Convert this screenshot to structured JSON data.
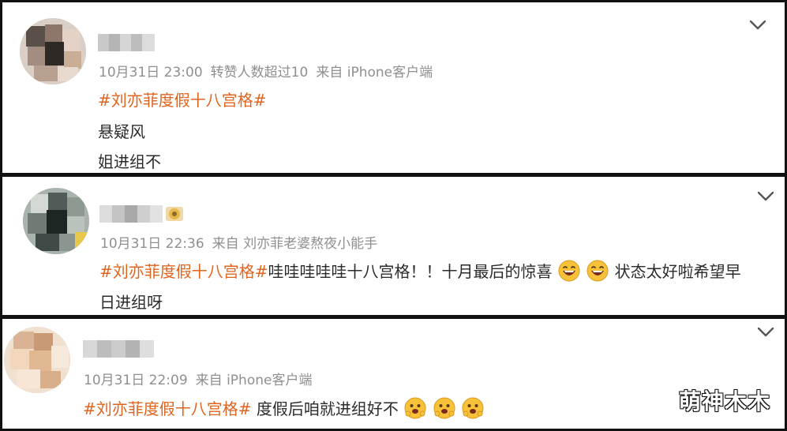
{
  "comments": [
    {
      "meta": {
        "date": "10月31日 23:00",
        "likes": "转赞人数超过10",
        "source": "来自 iPhone客户端"
      },
      "hashtag": "#刘亦菲度假十八宫格#",
      "lines": [
        "悬疑风",
        "姐进组不"
      ]
    },
    {
      "meta": {
        "date": "10月31日 22:36",
        "source": "来自 刘亦菲老婆熬夜小能手"
      },
      "hashtag": "#刘亦菲度假十八宫格#",
      "line1_text": "哇哇哇哇哇十八宫格！！十月最后的惊喜",
      "line1_tail": "状态太好啦希望早",
      "line2": "日进组呀"
    },
    {
      "meta": {
        "date": "10月31日 22:09",
        "source": "来自 iPhone客户端"
      },
      "hashtag": "#刘亦菲度假十八宫格#",
      "text": "度假后咱就进组好不"
    }
  ],
  "icons": {
    "collapse": "chevron-down-icon",
    "emoji_laugh": "laughing-emoji-icon",
    "emoji_scared": "scared-emoji-icon",
    "badge": "member-badge-icon"
  },
  "colors": {
    "hashtag": "#e0641e",
    "meta": "#8f8f8f",
    "text": "#2b2b2b"
  },
  "watermark": "萌神木木"
}
